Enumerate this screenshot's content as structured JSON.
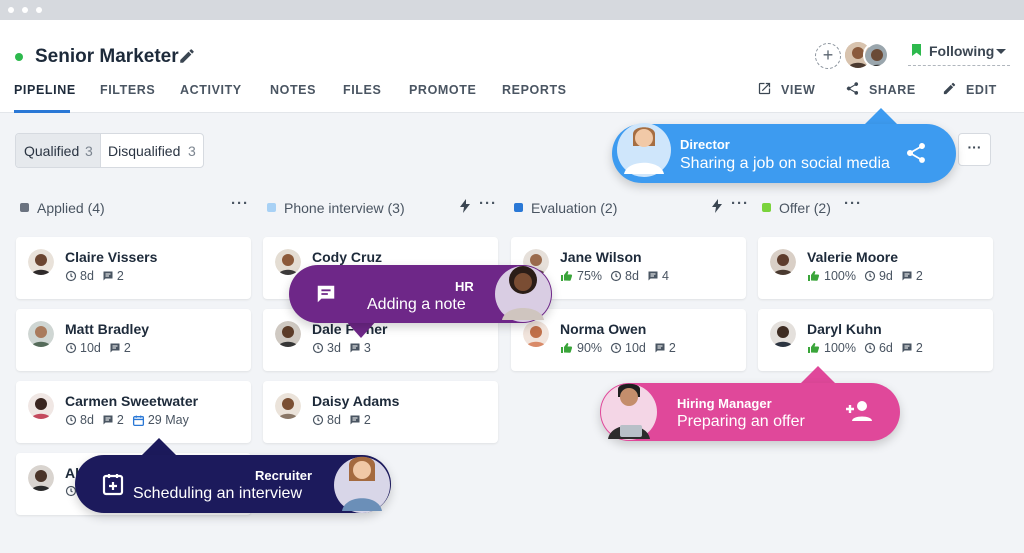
{
  "header": {
    "job_title": "Senior Marketer",
    "following_label": "Following",
    "add_symbol": "+"
  },
  "tabs": [
    "PIPELINE",
    "FILTERS",
    "ACTIVITY",
    "NOTES",
    "FILES",
    "PROMOTE",
    "REPORTS"
  ],
  "actions": {
    "view": "VIEW",
    "share": "SHARE",
    "edit": "EDIT"
  },
  "filters": {
    "qualified_label": "Qualified",
    "qualified_count": "3",
    "disqualified_label": "Disqualified",
    "disqualified_count": "3",
    "more_label": "···"
  },
  "columns": [
    {
      "name": "Applied (4)",
      "color": "#6b7380"
    },
    {
      "name": "Phone interview (3)",
      "color": "#a8d1f5"
    },
    {
      "name": "Evaluation (2)",
      "color": "#2a78d6"
    },
    {
      "name": "Offer (2)",
      "color": "#7ad33c"
    }
  ],
  "column_menu": "···",
  "cards": {
    "applied": [
      {
        "name": "Claire Vissers",
        "days": "8d",
        "comments": "2"
      },
      {
        "name": "Matt Bradley",
        "days": "10d",
        "comments": "2"
      },
      {
        "name": "Carmen Sweetwater",
        "days": "8d",
        "comments": "2",
        "date": "29 May"
      },
      {
        "name": "Al",
        "days": ""
      }
    ],
    "phone": [
      {
        "name": "Cody Cruz"
      },
      {
        "name": "Dale F   cher",
        "days": "3d",
        "comments": "3"
      },
      {
        "name": "Daisy Adams",
        "days": "8d",
        "comments": "2"
      }
    ],
    "evaluation": [
      {
        "name": "Jane Wilson",
        "score": "75%",
        "days": "8d",
        "comments": "4"
      },
      {
        "name": "Norma Owen",
        "score": "90%",
        "days": "10d",
        "comments": "2"
      }
    ],
    "offer": [
      {
        "name": "Valerie Moore",
        "score": "100%",
        "days": "9d",
        "comments": "2"
      },
      {
        "name": "Daryl Kuhn",
        "score": "100%",
        "days": "6d",
        "comments": "2"
      }
    ]
  },
  "callouts": {
    "director": {
      "role": "Director",
      "text": "Sharing a job on social media",
      "color": "#3d9bf0"
    },
    "hr": {
      "role": "HR",
      "text": "Adding a note",
      "color": "#6e2788"
    },
    "hiring": {
      "role": "Hiring Manager",
      "text": "Preparing an offer",
      "color": "#e0489a"
    },
    "recruiter": {
      "role": "Recruiter",
      "text": "Scheduling an interview",
      "color": "#1c1a5c"
    }
  }
}
